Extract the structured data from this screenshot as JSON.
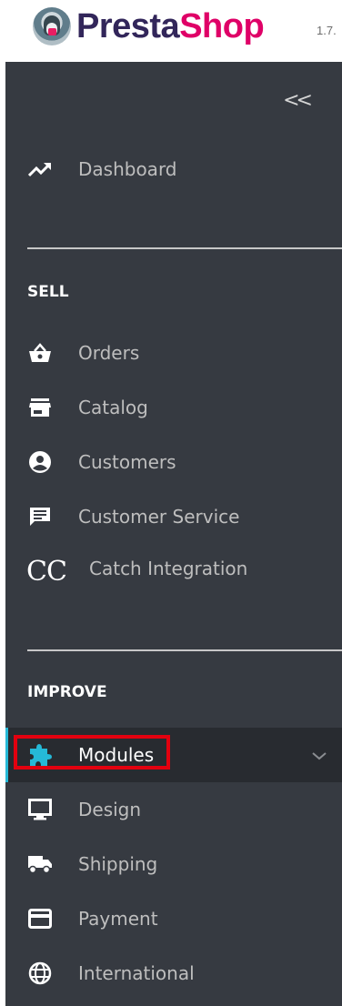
{
  "header": {
    "brand_part1": "Presta",
    "brand_part2": "Shop",
    "version": "1.7."
  },
  "sidebar": {
    "collapse_label": "<<",
    "dashboard": {
      "label": "Dashboard",
      "icon": "trending-up-icon"
    },
    "sell": {
      "title": "SELL",
      "items": [
        {
          "label": "Orders",
          "icon": "shopping-basket-icon"
        },
        {
          "label": "Catalog",
          "icon": "store-icon"
        },
        {
          "label": "Customers",
          "icon": "account-circle-icon"
        },
        {
          "label": "Customer Service",
          "icon": "chat-icon"
        },
        {
          "label": "Catch Integration",
          "icon": "cc-icon",
          "icon_text": "CC"
        }
      ]
    },
    "improve": {
      "title": "IMPROVE",
      "items": [
        {
          "label": "Modules",
          "icon": "puzzle-icon",
          "active": true,
          "highlighted": true
        },
        {
          "label": "Design",
          "icon": "desktop-icon"
        },
        {
          "label": "Shipping",
          "icon": "truck-icon"
        },
        {
          "label": "Payment",
          "icon": "credit-card-icon"
        },
        {
          "label": "International",
          "icon": "globe-icon"
        }
      ]
    }
  },
  "colors": {
    "sidebar_bg": "#363a41",
    "active_bg": "#282b30",
    "accent": "#25b9d7",
    "highlight": "#e3000f",
    "brand_dark": "#32265a",
    "brand_pink": "#df0067"
  }
}
